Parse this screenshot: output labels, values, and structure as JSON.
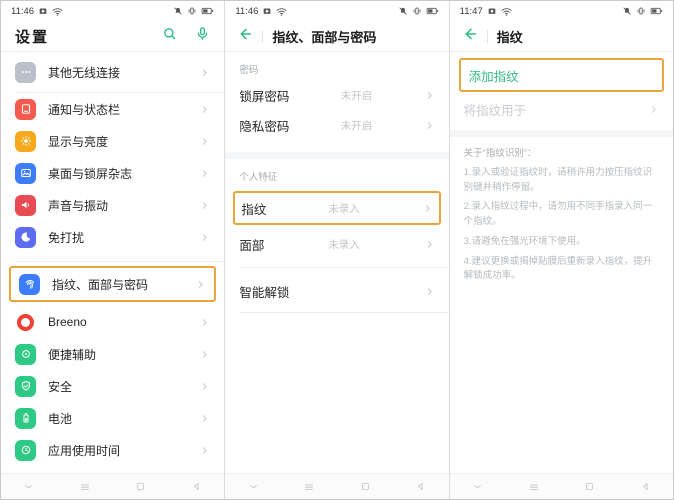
{
  "colors": {
    "accent_green": "#2abb7f",
    "highlight_orange": "#e9a43e",
    "value_gray": "#c6c6c6",
    "icon_gray": "#b9c0ca",
    "icon_red": "#f45a4d",
    "icon_orange": "#f7a81c",
    "icon_blue": "#3d7dfb",
    "icon_red2": "#e94b55",
    "icon_indigo": "#5f6cf0",
    "icon_green": "#2ec984",
    "breeno_ring": "#ef4136"
  },
  "left": {
    "status_time": "11:46",
    "title": "设置",
    "items": [
      {
        "label": "其他无线连接",
        "icon": "ellipsis-icon"
      },
      {
        "label": "通知与状态栏",
        "icon": "notification-icon"
      },
      {
        "label": "显示与亮度",
        "icon": "sun-icon"
      },
      {
        "label": "桌面与锁屏杂志",
        "icon": "picture-icon"
      },
      {
        "label": "声音与振动",
        "icon": "speaker-icon"
      },
      {
        "label": "免打扰",
        "icon": "moon-icon"
      },
      {
        "label": "指纹、面部与密码",
        "icon": "fingerprint-icon"
      },
      {
        "label": "Breeno",
        "icon": "breeno-ring-icon"
      },
      {
        "label": "便捷辅助",
        "icon": "assist-icon"
      },
      {
        "label": "安全",
        "icon": "shield-check-icon"
      },
      {
        "label": "电池",
        "icon": "battery-icon"
      },
      {
        "label": "应用使用时间",
        "icon": "clock-icon"
      }
    ]
  },
  "middle": {
    "status_time": "11:46",
    "title": "指纹、面部与密码",
    "section_password": "密码",
    "section_personal": "个人特征",
    "rows": [
      {
        "label": "锁屏密码",
        "value": "未开启"
      },
      {
        "label": "隐私密码",
        "value": "未开启"
      },
      {
        "label": "指纹",
        "value": "未录入"
      },
      {
        "label": "面部",
        "value": "未录入"
      },
      {
        "label": "智能解锁",
        "value": ""
      }
    ]
  },
  "right": {
    "status_time": "11:47",
    "title": "指纹",
    "add_button": "添加指纹",
    "disabled_row": "将指纹用于",
    "about_title": "关于“指纹识别”：",
    "tips": [
      "1.录入或验证指纹时，请稍许用力按压指纹识别键并稍作停留。",
      "2.录入指纹过程中，请勿用不同手指录入同一个指纹。",
      "3.请避免在强光环境下使用。",
      "4.建议更换或揭掉贴膜后重新录入指纹，提升解锁成功率。"
    ]
  }
}
